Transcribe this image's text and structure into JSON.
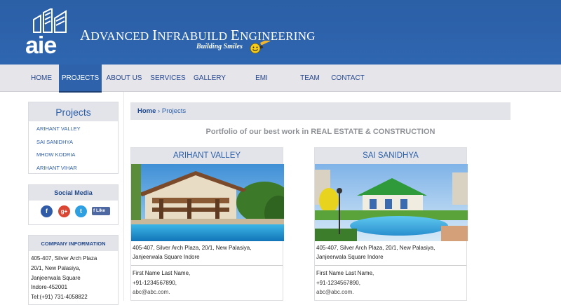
{
  "header": {
    "logo_text": "aie",
    "brand_name": "Advanced Infrabuild Engineering",
    "brand_words": [
      {
        "first": "A",
        "rest": "DVANCED"
      },
      {
        "first": "I",
        "rest": "NFRABUILD"
      },
      {
        "first": "E",
        "rest": "NGINEERING"
      }
    ],
    "tagline": "Building Smiles"
  },
  "nav": {
    "items": [
      {
        "label": "HOME",
        "active": false
      },
      {
        "label": "PROJECTS",
        "active": true
      },
      {
        "label": "ABOUT US",
        "active": false
      },
      {
        "label": "SERVICES",
        "active": false
      },
      {
        "label": "GALLERY",
        "active": false
      },
      {
        "label": "EMI CALCULATOR",
        "active": false
      },
      {
        "label": "TEAM",
        "active": false
      },
      {
        "label": "CONTACT",
        "active": false
      }
    ]
  },
  "sidebar": {
    "projects_title": "Projects",
    "projects": [
      "ARIHANT VALLEY",
      "SAI SANIDHYA",
      "MHOW KODRIA",
      "ARIHANT VIHAR"
    ],
    "social_title": "Social Media",
    "social": {
      "facebook_icon": "facebook-icon",
      "gplus_icon": "google-plus-icon",
      "twitter_icon": "twitter-icon",
      "like_label": "Like"
    },
    "company_title": "COMPANY INFORMATION",
    "company_lines": [
      "405-407, Silver Arch Plaza",
      "20/1, New Palasiya,",
      "Janjeerwala Square",
      "Indore-452001",
      "Tel:(+91) 731-4058822"
    ]
  },
  "breadcrumb": {
    "home": "Home",
    "separator": "›",
    "current": "Projects"
  },
  "main": {
    "intro": "Portfolio of our best work in REAL ESTATE & CONSTRUCTION",
    "cards": [
      {
        "title": "ARIHANT VALLEY",
        "address": "405-407, Silver Arch Plaza, 20/1, New Palasiya, Janjeerwala Square Indore",
        "contact_name": "First Name Last Name,",
        "phone": "+91-1234567890,",
        "email": "abc@abc.com."
      },
      {
        "title": "SAI SANIDHYA",
        "address": "405-407, Silver Arch Plaza, 20/1, New Palasiya, Janjeerwala Square Indore",
        "contact_name": "First Name Last Name,",
        "phone": "+91-1234567890,",
        "email": "abc@abc.com."
      }
    ]
  },
  "colors": {
    "header_blue": "#2f66b0",
    "nav_bg": "#e5e5ea",
    "link_blue": "#2c5fa8"
  }
}
